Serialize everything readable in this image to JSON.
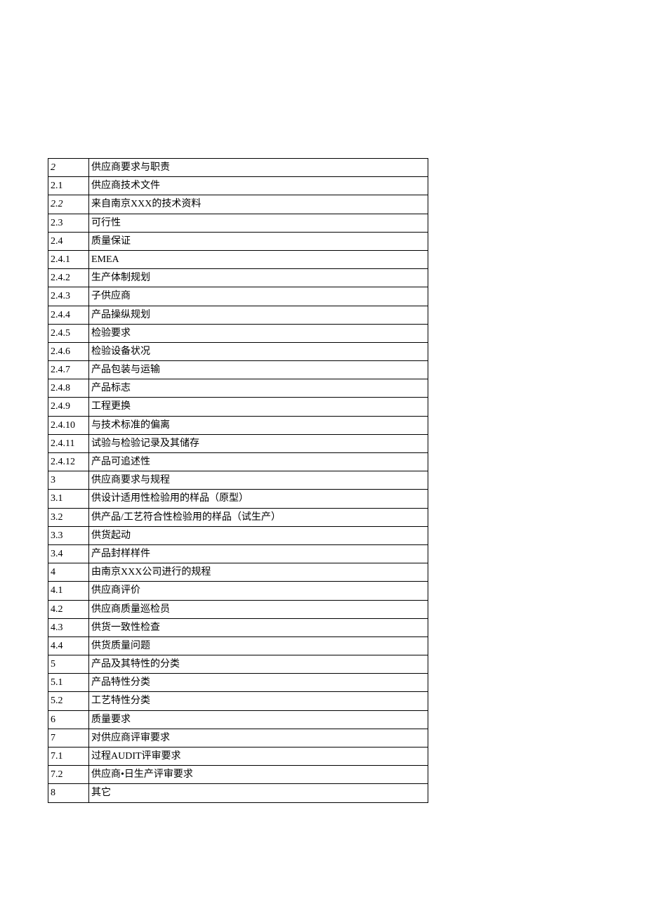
{
  "toc": [
    {
      "num": "2",
      "title": "供应商要求与职责",
      "italic": true
    },
    {
      "num": "2.1",
      "title": "供应商技术文件"
    },
    {
      "num": "2.2",
      "title": "来自南京XXX的技术资料",
      "italic": true
    },
    {
      "num": "2.3",
      "title": "可行性"
    },
    {
      "num": "2.4",
      "title": "质量保证"
    },
    {
      "num": "2.4.1",
      "title": "EMEA"
    },
    {
      "num": "2.4.2",
      "title": "生产体制规划"
    },
    {
      "num": "2.4.3",
      "title": "子供应商"
    },
    {
      "num": "2.4.4",
      "title": "产品操纵规划"
    },
    {
      "num": "2.4.5",
      "title": "检验要求"
    },
    {
      "num": "2.4.6",
      "title": "检验设备状况"
    },
    {
      "num": "2.4.7",
      "title": "产品包装与运输"
    },
    {
      "num": "2.4.8",
      "title": "产品标志"
    },
    {
      "num": "2.4.9",
      "title": "工程更换"
    },
    {
      "num": "2.4.10",
      "title": "与技术标准的偏离"
    },
    {
      "num": "2.4.11",
      "title": "试验与检验记录及其储存"
    },
    {
      "num": "2.4.12",
      "title": "产品可追述性"
    },
    {
      "num": "3",
      "title": "供应商要求与规程"
    },
    {
      "num": "3.1",
      "title": "供设计适用性检验用的样品（原型）"
    },
    {
      "num": "3.2",
      "title": "供产品/工艺符合性检验用的样品（试生产）"
    },
    {
      "num": "3.3",
      "title": "供货起动"
    },
    {
      "num": "3.4",
      "title": "产品封样样件"
    },
    {
      "num": "4",
      "title": "由南京XXX公司进行的规程"
    },
    {
      "num": "4.1",
      "title": "供应商评价"
    },
    {
      "num": "4.2",
      "title": "供应商质量巡检员"
    },
    {
      "num": "4.3",
      "title": "供货一致性检查"
    },
    {
      "num": "4.4",
      "title": "供货质量问题"
    },
    {
      "num": "5",
      "title": "产品及其特性的分类"
    },
    {
      "num": "5.1",
      "title": "产品特性分类"
    },
    {
      "num": "5.2",
      "title": "工艺特性分类"
    },
    {
      "num": "6",
      "title": "质量要求"
    },
    {
      "num": "7",
      "title": "对供应商评审要求"
    },
    {
      "num": "7.1",
      "title": "过程AUDIT评审要求"
    },
    {
      "num": "7.2",
      "title": "供应商•日生产评审要求"
    },
    {
      "num": "8",
      "title": "其它"
    }
  ]
}
